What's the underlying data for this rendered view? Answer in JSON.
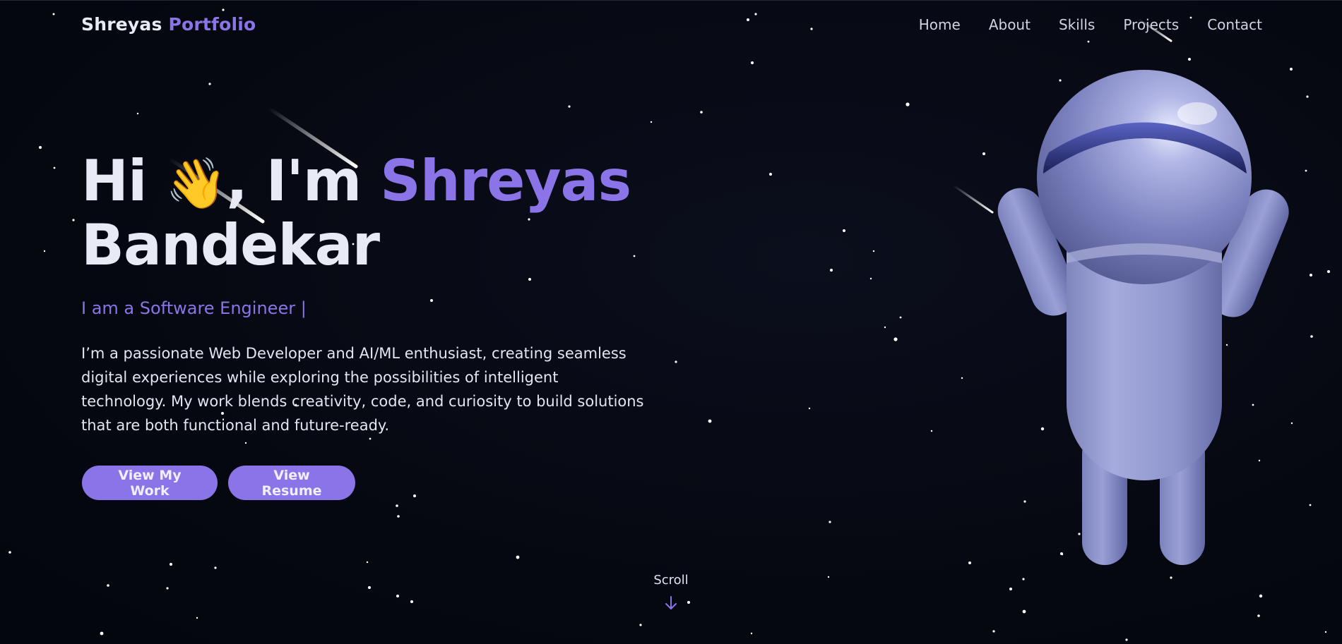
{
  "brand": {
    "first": "Shreyas",
    "second": "Portfolio"
  },
  "nav": {
    "items": [
      "Home",
      "About",
      "Skills",
      "Projects",
      "Contact"
    ]
  },
  "hero": {
    "greeting": "Hi",
    "wave": "👋",
    "im": ", I'm",
    "name_first": "Shreyas",
    "name_last": "Bandekar",
    "subtitle": "I am a Software Engineer |",
    "bio": "I’m a passionate Web Developer and AI/ML enthusiast, creating seamless digital experiences while exploring the possibilities of intelligent technology. My work blends creativity, code, and curiosity to build solutions that are both functional and future-ready.",
    "primary_button": "View My Work",
    "secondary_button": "View Resume"
  },
  "scroll": {
    "label": "Scroll",
    "icon": "arrow-down-icon"
  },
  "colors": {
    "background": "#060811",
    "accent": "#8a74e8",
    "text": "#e8ebf5",
    "robot": "#8d93c8"
  },
  "illustration": {
    "name": "robot-3d-illustration"
  }
}
